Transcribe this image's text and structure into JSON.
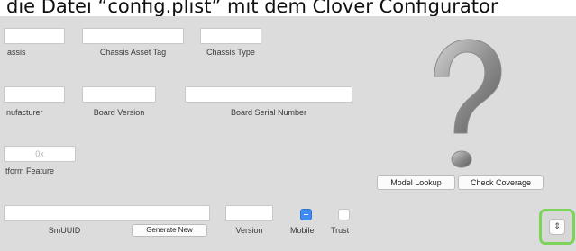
{
  "caption": "die Datei “config.plist” mit dem Clover Configurator",
  "smbios": {
    "row1": {
      "chassis": "assis",
      "asset_tag": "Chassis  Asset Tag",
      "chassis_type": "Chassis Type"
    },
    "row2": {
      "manufacturer": "nufacturer",
      "board_version": "Board Version",
      "board_serial": "Board Serial Number"
    },
    "row3": {
      "platform_value": "0x",
      "platform_label": "tform Feature"
    },
    "row4": {
      "smuuid": "SmUUID",
      "generate_button": "Generate New",
      "version": "Version",
      "mobile": "Mobile",
      "trust": "Trust"
    },
    "mobile_checked": true,
    "trust_checked": false
  },
  "actions": {
    "model_lookup": "Model Lookup",
    "check_coverage": "Check Coverage"
  },
  "icons": {
    "help": "question-mark-icon",
    "stepper": "stepper-icon"
  },
  "colors": {
    "highlight": "#7ed35a",
    "checkbox_blue": "#3f8df4"
  }
}
